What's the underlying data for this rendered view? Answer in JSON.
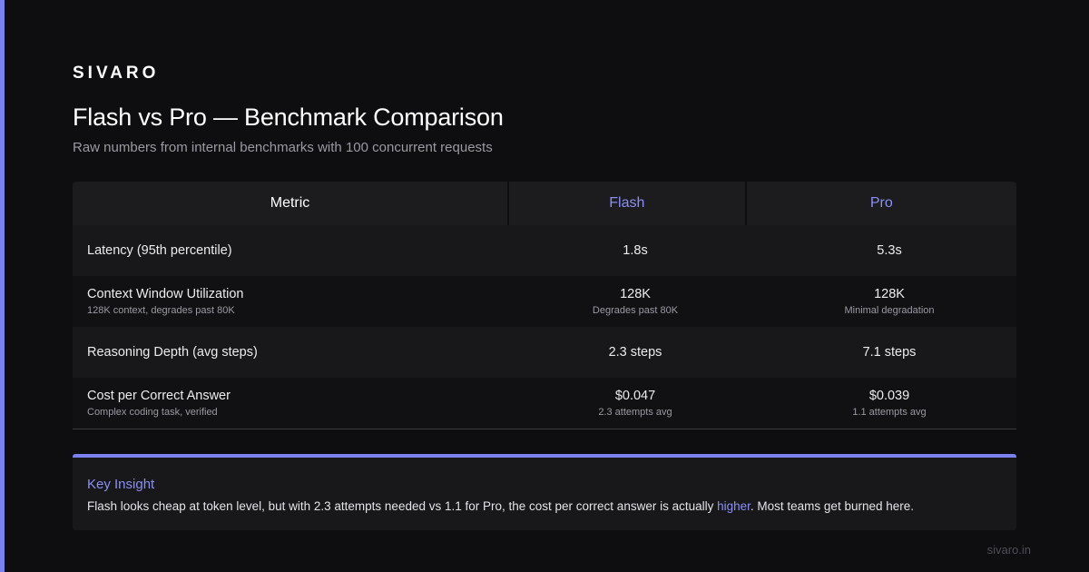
{
  "brand": "SIVARO",
  "title": "Flash vs Pro — Benchmark Comparison",
  "subtitle": "Raw numbers from internal benchmarks with 100 concurrent requests",
  "table": {
    "headers": {
      "metric": "Metric",
      "flash": "Flash",
      "pro": "Pro"
    },
    "rows": [
      {
        "metric": "Latency (95th percentile)",
        "note": "",
        "flash": "1.8s",
        "flash_note": "",
        "pro": "5.3s",
        "pro_note": ""
      },
      {
        "metric": "Context Window Utilization",
        "note": "128K context, degrades past 80K",
        "flash": "128K",
        "flash_note": "Degrades past 80K",
        "pro": "128K",
        "pro_note": "Minimal degradation"
      },
      {
        "metric": "Reasoning Depth (avg steps)",
        "note": "",
        "flash": "2.3 steps",
        "flash_note": "",
        "pro": "7.1 steps",
        "pro_note": ""
      },
      {
        "metric": "Cost per Correct Answer",
        "note": "Complex coding task, verified",
        "flash": "$0.047",
        "flash_note": "2.3 attempts avg",
        "pro": "$0.039",
        "pro_note": "1.1 attempts avg"
      }
    ]
  },
  "insight": {
    "title": "Key Insight",
    "text_before": "Flash looks cheap at token level, but with 2.3 attempts needed vs 1.1 for Pro, the cost per correct answer is actually ",
    "highlight": "higher",
    "text_after": ". Most teams get burned here."
  },
  "footer": "sivaro.in",
  "colors": {
    "accent": "#7b82f0",
    "background": "#0e0e10"
  }
}
